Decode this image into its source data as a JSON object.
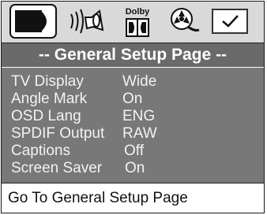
{
  "icon_bar": {
    "tabs": [
      {
        "icon": "tv-icon",
        "selected": true
      },
      {
        "icon": "speaker-audio-icon",
        "selected": false
      },
      {
        "icon": "dolby-icon",
        "label": "Dolby",
        "selected": false
      },
      {
        "icon": "video-reel-icon",
        "selected": false
      },
      {
        "icon": "checkmark-icon",
        "selected": false
      }
    ]
  },
  "page": {
    "title": "-- General Setup Page --"
  },
  "settings": [
    {
      "label": "TV Display",
      "value": "Wide"
    },
    {
      "label": "Angle Mark",
      "value": "On"
    },
    {
      "label": "OSD Lang",
      "value": "ENG"
    },
    {
      "label": "SPDIF Output",
      "value": "RAW"
    },
    {
      "label": "Captions",
      "value": "Off"
    },
    {
      "label": "Screen Saver",
      "value": "On"
    }
  ],
  "status_bar": {
    "text": "Go To General Setup Page"
  },
  "colors": {
    "menu_bg": "#787878",
    "title_bg": "#6a6a6a",
    "icon_bar_bg": "#d9d9d9",
    "text": "#f2f2f2"
  }
}
